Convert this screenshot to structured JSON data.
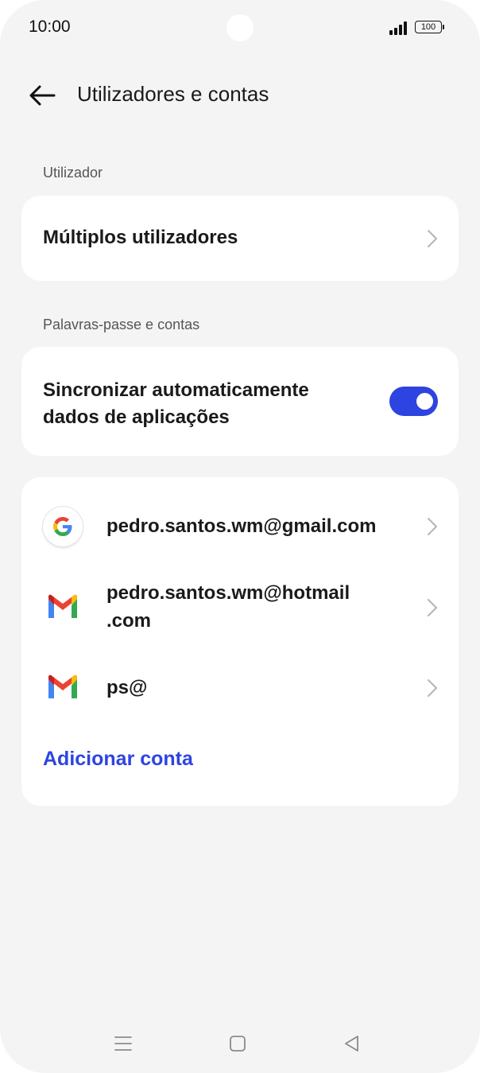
{
  "status_bar": {
    "time": "10:00",
    "battery": "100",
    "icons": [
      "signal-icon",
      "battery-icon"
    ]
  },
  "header": {
    "title": "Utilizadores e contas",
    "back_icon": "arrow-left-icon"
  },
  "sections": {
    "user": {
      "label": "Utilizador",
      "multiple_users": "Múltiplos utilizadores"
    },
    "accounts": {
      "label": "Palavras-passe e contas",
      "auto_sync_line1": "Sincronizar automaticamente",
      "auto_sync_line2": "dados de aplicações",
      "auto_sync_enabled": true
    }
  },
  "accounts": [
    {
      "icon": "google-icon",
      "email": "pedro.santos.wm@gmail.com"
    },
    {
      "icon": "gmail-icon",
      "email_line1": "pedro.santos.wm@hotmail",
      "email_line2": ".com"
    },
    {
      "icon": "gmail-icon",
      "email": "ps@"
    }
  ],
  "add_account_label": "Adicionar conta",
  "colors": {
    "accent": "#2e44e0",
    "background": "#f4f4f4",
    "card": "#ffffff"
  },
  "nav_bar": {
    "icons": [
      "menu-icon",
      "home-icon",
      "back-triangle-icon"
    ]
  }
}
